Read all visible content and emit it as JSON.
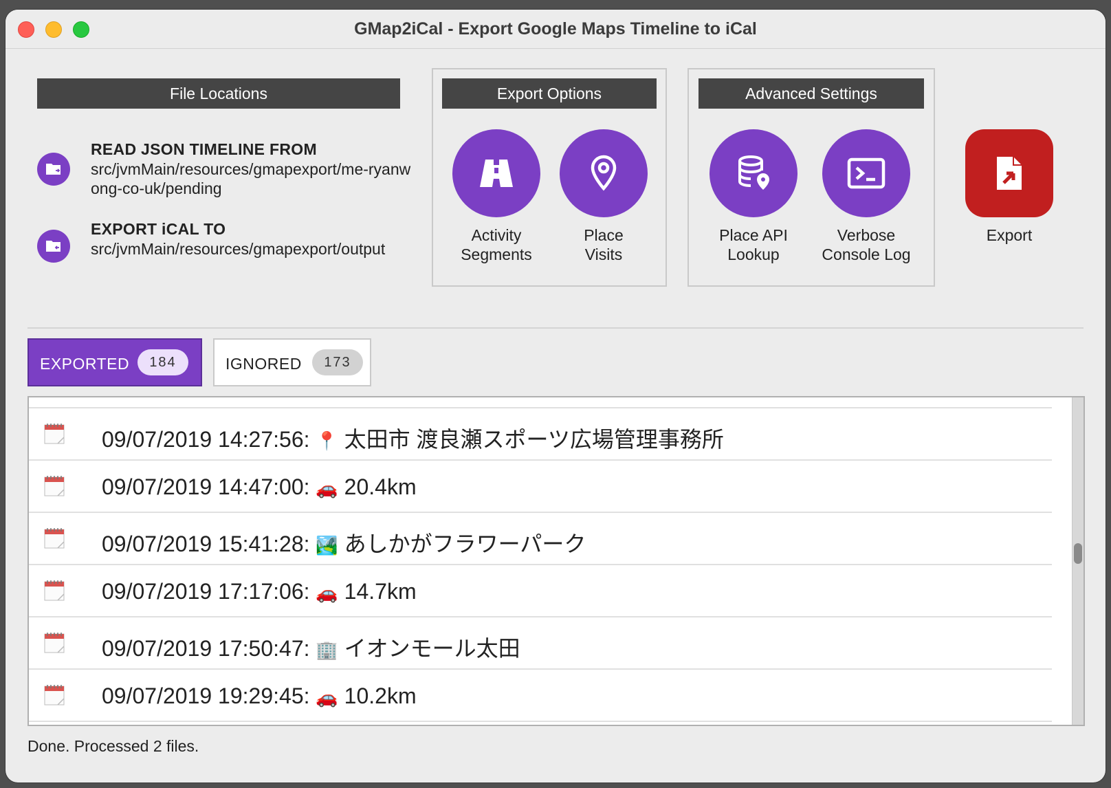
{
  "window": {
    "title": "GMap2iCal - Export Google Maps Timeline to iCal"
  },
  "file_locations": {
    "header": "File Locations",
    "read": {
      "label": "READ JSON TIMELINE FROM",
      "path": "src/jvmMain/resources/gmapexport/me-ryanwong-co-uk/pending",
      "icon": "folder-open-icon"
    },
    "export": {
      "label": "EXPORT iCAL TO",
      "path": "src/jvmMain/resources/gmapexport/output",
      "icon": "folder-save-icon"
    }
  },
  "export_options": {
    "header": "Export Options",
    "buttons": [
      {
        "label_line1": "Activity",
        "label_line2": "Segments",
        "icon": "road-icon"
      },
      {
        "label_line1": "Place",
        "label_line2": "Visits",
        "icon": "map-pin-icon"
      }
    ]
  },
  "advanced_settings": {
    "header": "Advanced Settings",
    "buttons": [
      {
        "label_line1": "Place API",
        "label_line2": "Lookup",
        "icon": "database-pin-icon"
      },
      {
        "label_line1": "Verbose",
        "label_line2": "Console Log",
        "icon": "terminal-icon"
      }
    ]
  },
  "export_button": {
    "label": "Export",
    "icon": "file-export-icon",
    "color": "#c11f1f"
  },
  "accent_color": "#7b3fc4",
  "tabs": [
    {
      "label": "EXPORTED",
      "count": "184",
      "selected": true
    },
    {
      "label": "IGNORED",
      "count": "173",
      "selected": false
    }
  ],
  "list": {
    "rows": [
      {
        "timestamp": "09/07/2019 14:27:56:",
        "emoji": "📍",
        "text": "太田市 渡良瀬スポーツ広場管理事務所"
      },
      {
        "timestamp": "09/07/2019 14:47:00:",
        "emoji": "🚗",
        "text": "20.4km"
      },
      {
        "timestamp": "09/07/2019 15:41:28:",
        "emoji": "🏞️",
        "text": "あしかがフラワーパーク"
      },
      {
        "timestamp": "09/07/2019 17:17:06:",
        "emoji": "🚗",
        "text": "14.7km"
      },
      {
        "timestamp": "09/07/2019 17:50:47:",
        "emoji": "🏢",
        "text": "イオンモール太田"
      },
      {
        "timestamp": "09/07/2019 19:29:45:",
        "emoji": "🚗",
        "text": "10.2km"
      }
    ]
  },
  "status": "Done. Processed 2 files."
}
